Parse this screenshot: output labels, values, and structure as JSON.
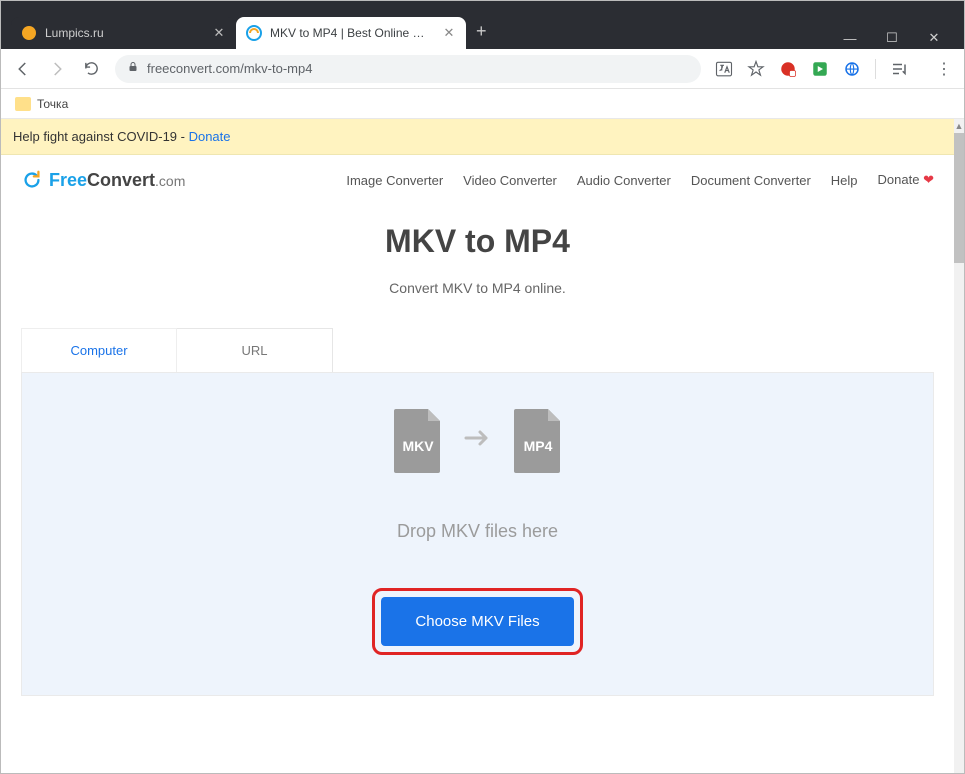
{
  "window": {
    "tabs": [
      {
        "title": "Lumpics.ru",
        "active": false
      },
      {
        "title": "MKV to MP4 | Best Online MKV t…",
        "active": true
      }
    ]
  },
  "address_bar": {
    "url": "freeconvert.com/mkv-to-mp4"
  },
  "bookmarks": {
    "item1": "Точка"
  },
  "banner": {
    "text_prefix": "Help fight against COVID-19 - ",
    "link_text": "Donate"
  },
  "logo": {
    "part1": "Free",
    "part2": "Convert",
    "part3": ".com"
  },
  "nav": {
    "image": "Image Converter",
    "video": "Video Converter",
    "audio": "Audio Converter",
    "document": "Document Converter",
    "help": "Help",
    "donate": "Donate"
  },
  "page": {
    "title": "MKV to MP4",
    "subtitle": "Convert MKV to MP4 online."
  },
  "source_tabs": {
    "computer": "Computer",
    "url": "URL"
  },
  "drop": {
    "from_ext": "MKV",
    "to_ext": "MP4",
    "text": "Drop MKV files here",
    "button": "Choose MKV Files"
  }
}
